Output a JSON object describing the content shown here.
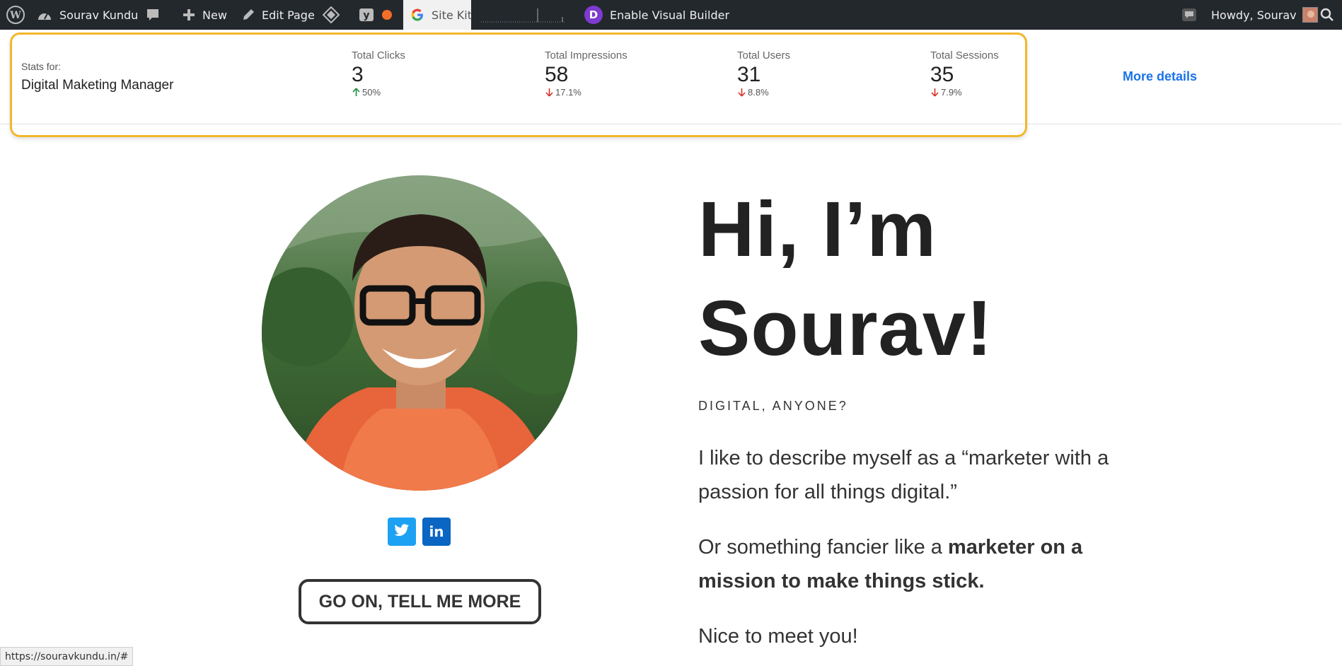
{
  "adminbar": {
    "site_name": "Sourav Kundu",
    "new_label": "New",
    "edit_label": "Edit Page",
    "sitekit_label": "Site Kit",
    "visual_builder_label": "Enable Visual Builder",
    "howdy_label": "Howdy, Sourav",
    "divi_letter": "D"
  },
  "stats": {
    "stats_for_label": "Stats for:",
    "page_name": "Digital Maketing Manager",
    "metrics": [
      {
        "label": "Total Clicks",
        "value": "3",
        "change": "50%",
        "direction": "up"
      },
      {
        "label": "Total Impressions",
        "value": "58",
        "change": "17.1%",
        "direction": "down"
      },
      {
        "label": "Total Users",
        "value": "31",
        "change": "8.8%",
        "direction": "down"
      },
      {
        "label": "Total Sessions",
        "value": "35",
        "change": "7.9%",
        "direction": "down"
      }
    ],
    "more_details_label": "More details",
    "colors": {
      "up": "#1e8e3e",
      "down": "#d93025",
      "link": "#1a73e8",
      "highlight": "#f3b72a"
    }
  },
  "hero": {
    "title_line1": "Hi, I’m",
    "title_line2": "Sourav!",
    "eyebrow": "DIGITAL, ANYONE?",
    "para1": "I like to describe myself as a “marketer with a passion for all things digital.”",
    "para2_prefix": "Or something fancier like a ",
    "para2_bold": "marketer on a mission to make things stick.",
    "para3": "Nice to meet you!",
    "cta_label": "GO ON, TELL ME MORE",
    "linkedin_label": "in"
  },
  "statusbar": {
    "url": "https://souravkundu.in/#"
  }
}
